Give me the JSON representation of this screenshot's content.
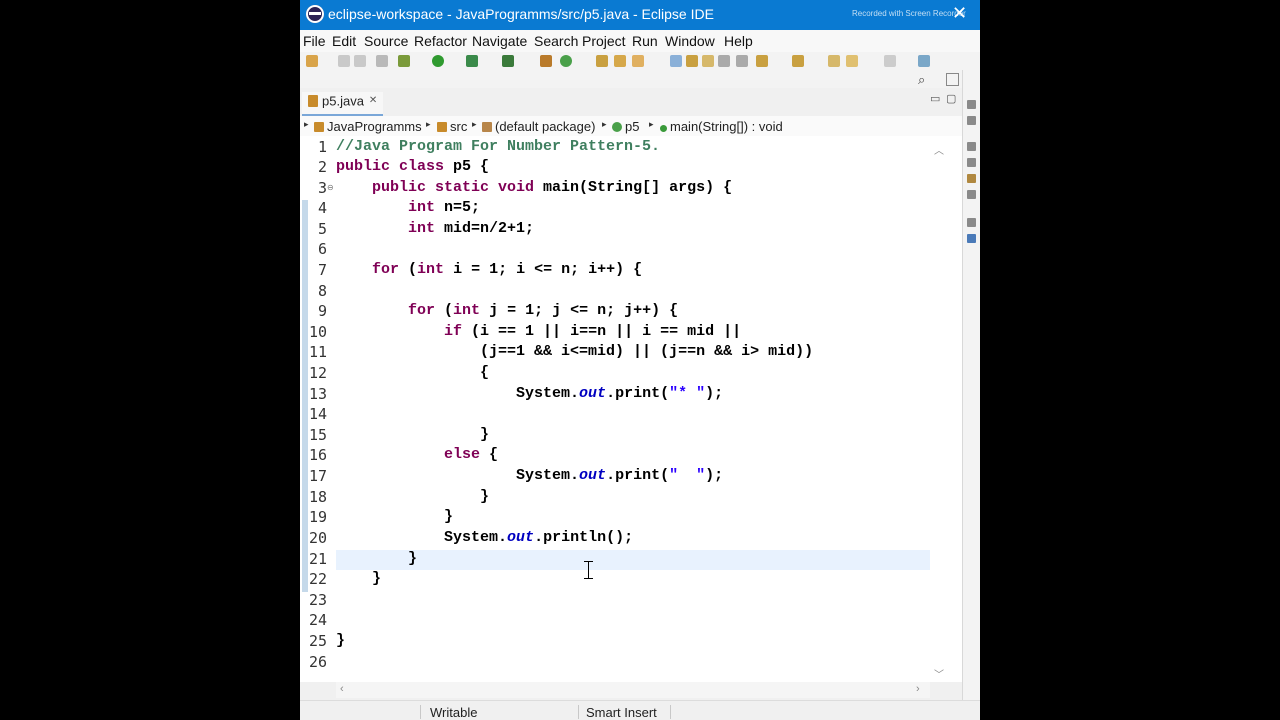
{
  "window": {
    "title": "eclipse-workspace - JavaProgramms/src/p5.java - Eclipse IDE",
    "recorder_label": "Recorded with  Screen Recorder"
  },
  "menu": [
    "File",
    "Edit",
    "Source",
    "Refactor",
    "Navigate",
    "Search",
    "Project",
    "Run",
    "Window",
    "Help"
  ],
  "editor_tab": {
    "label": "p5.java",
    "close": "✕"
  },
  "breadcrumb": [
    "JavaProgramms",
    "src",
    "(default package)",
    "p5",
    "main(String[]) : void"
  ],
  "code": {
    "line_numbers": [
      "1",
      "2",
      "3",
      "4",
      "5",
      "6",
      "7",
      "8",
      "9",
      "10",
      "11",
      "12",
      "13",
      "14",
      "15",
      "16",
      "17",
      "18",
      "19",
      "20",
      "21",
      "22",
      "23",
      "24",
      "25",
      "26"
    ],
    "l1": "//Java Program For Number Pattern-5.",
    "l2_kw": "public class",
    "l2_rest": " p5 {",
    "l3_kw": "public static void",
    "l3_rest": " main(String[] args) {",
    "l4_kw": "int",
    "l4_rest": " n=5;",
    "l5_kw": "int",
    "l5_rest": " mid=n/2+1;",
    "l7_kw": "for",
    "l7_a": " (",
    "l7_kw2": "int",
    "l7_rest": " i = 1; i <= n; i++) {",
    "l9_kw": "for",
    "l9_a": " (",
    "l9_kw2": "int",
    "l9_rest": " j = 1; j <= n; j++) {",
    "l10_kw": "if",
    "l10_rest": " (i == 1 || i==n || i == mid ||",
    "l11": "(j==1 && i<=mid) || (j==n && i> mid))",
    "l12": "{",
    "l13_a": "System.",
    "l13_field": "out",
    "l13_b": ".print(",
    "l13_str": "\"* \"",
    "l13_c": ");",
    "l15": "}",
    "l16_kw": "else",
    "l16_rest": " {",
    "l17_a": "System.",
    "l17_field": "out",
    "l17_b": ".print(",
    "l17_str": "\"  \"",
    "l17_c": ");",
    "l18": "}",
    "l19": "}",
    "l20_a": "System.",
    "l20_field": "out",
    "l20_b": ".println();",
    "l21": "}",
    "l22": "}",
    "l25": "}"
  },
  "status": {
    "writable": "Writable",
    "insert_mode": "Smart Insert"
  },
  "colors": {
    "titlebar": "#0a7ad2",
    "keyword": "#7f0055",
    "comment": "#3f7f5f",
    "string": "#2a00ff",
    "field": "#0000c0",
    "current_line": "#e8f2fe"
  }
}
